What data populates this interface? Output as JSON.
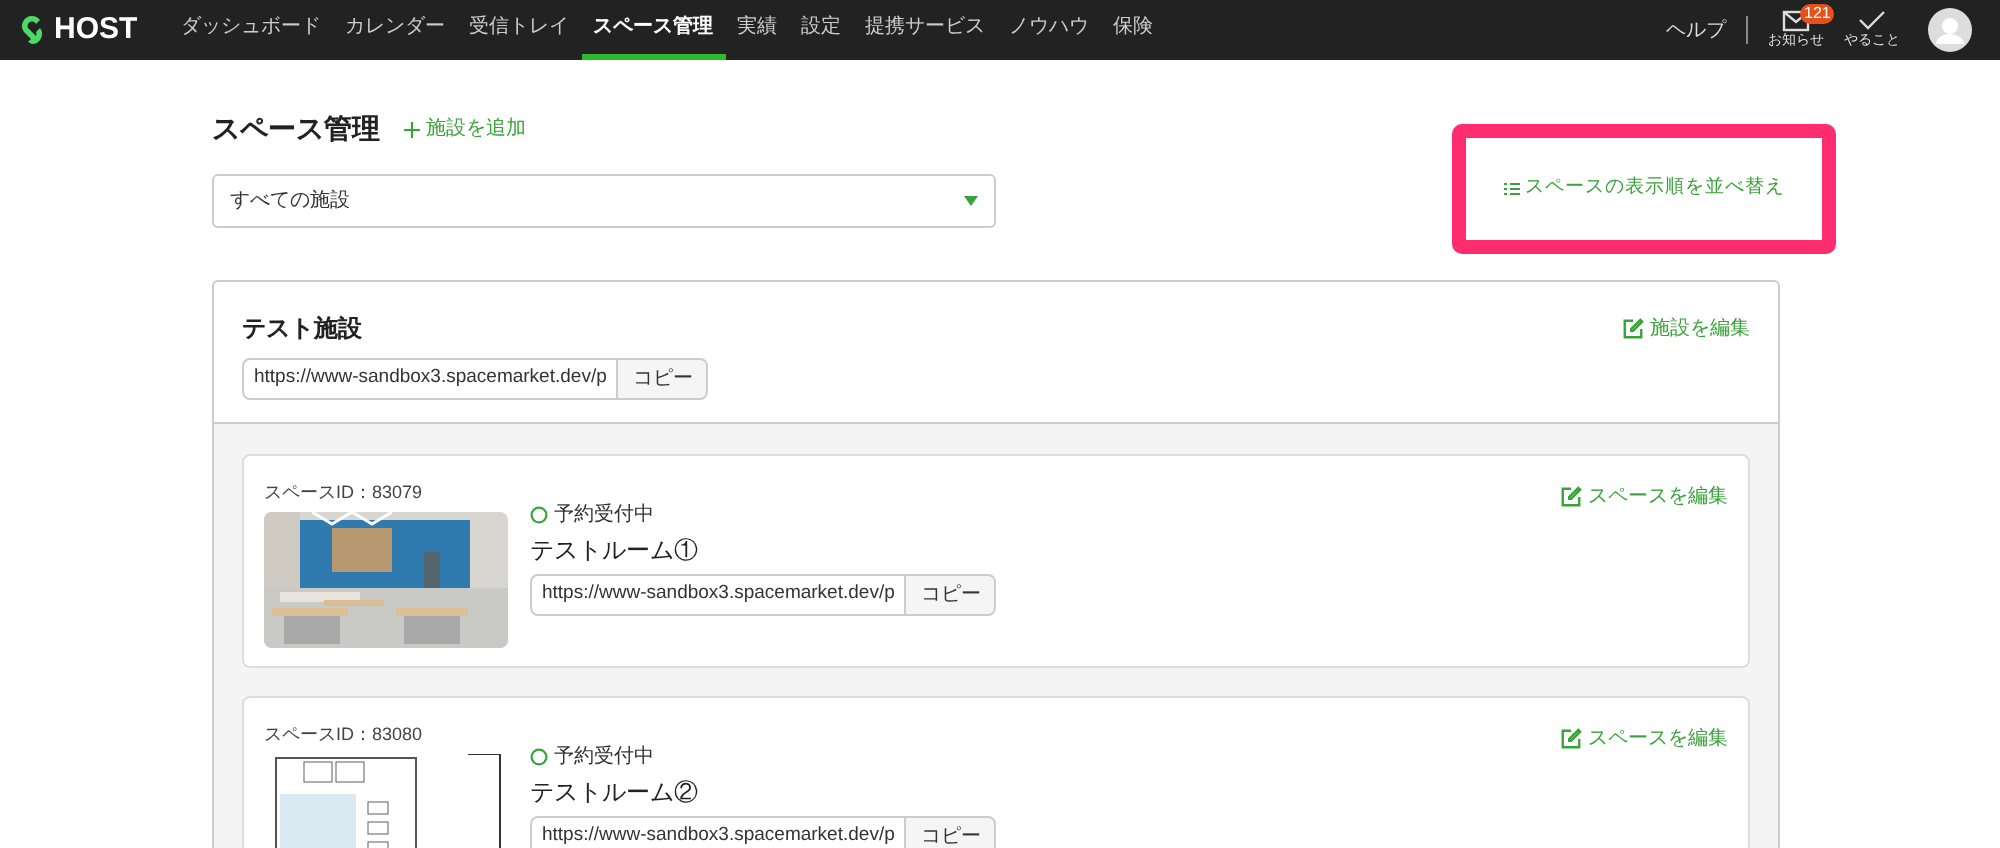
{
  "nav": {
    "logo": "HOST",
    "items": [
      {
        "label": "ダッシュボード",
        "selected": false
      },
      {
        "label": "カレンダー",
        "selected": false
      },
      {
        "label": "受信トレイ",
        "selected": false
      },
      {
        "label": "スペース管理",
        "selected": true
      },
      {
        "label": "実績",
        "selected": false
      },
      {
        "label": "設定",
        "selected": false
      },
      {
        "label": "提携サービス",
        "selected": false
      },
      {
        "label": "ノウハウ",
        "selected": false
      },
      {
        "label": "保険",
        "selected": false
      }
    ],
    "help": "ヘルプ",
    "notifications": {
      "label": "お知らせ",
      "badge": "121"
    },
    "todo": "やること"
  },
  "page": {
    "title": "スペース管理",
    "add_link": "施設を追加",
    "facility_select": "すべての施設",
    "sort_link": {
      "label": "スペースの表示順を並べ替え",
      "highlighted": true
    }
  },
  "facility": {
    "name": "テスト施設",
    "url": "https://www-sandbox3.spacemarket.dev/p",
    "copy": "コピー",
    "edit": "施設を編集",
    "spaces": [
      {
        "id_label": "スペースID：83079",
        "status": "予約受付中",
        "name": "テストルーム①",
        "url": "https://www-sandbox3.spacemarket.dev/p",
        "copy": "コピー",
        "edit": "スペースを編集"
      },
      {
        "kind": "floor_plan",
        "id_label": "スペースID：83080",
        "status": "予約受付中",
        "name": "テストルーム②",
        "url": "https://www-sandbox3.spacemarket.dev/p",
        "copy": "コピー",
        "edit": "スペースを編集"
      }
    ]
  }
}
